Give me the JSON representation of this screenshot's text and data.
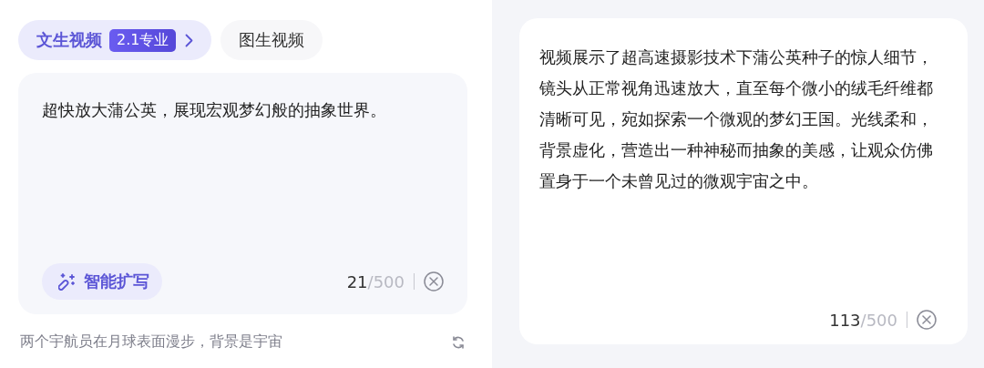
{
  "tabs": [
    {
      "label": "文生视频",
      "badge": "2.1专业",
      "dropdown": true,
      "selected": true
    },
    {
      "label": "图生视频",
      "dropdown": false,
      "selected": false
    }
  ],
  "prompt": {
    "value": "超快放大蒲公英，展现宏观梦幻般的抽象世界。",
    "expand_button": "智能扩写",
    "count": "21",
    "limit": "/500"
  },
  "suggestion": "两个宇航员在月球表面漫步，背景是宇宙",
  "result": {
    "text": "视频展示了超高速摄影技术下蒲公英种子的惊人细节，镜头从正常视角迅速放大，直至每个微小的绒毛纤维都清晰可见，宛如探索一个微观的梦幻王国。光线柔和，背景虚化，营造出一种神秘而抽象的美感，让观众仿佛置身于一个未曾见过的微观宇宙之中。",
    "count": "113",
    "limit": "/500"
  }
}
